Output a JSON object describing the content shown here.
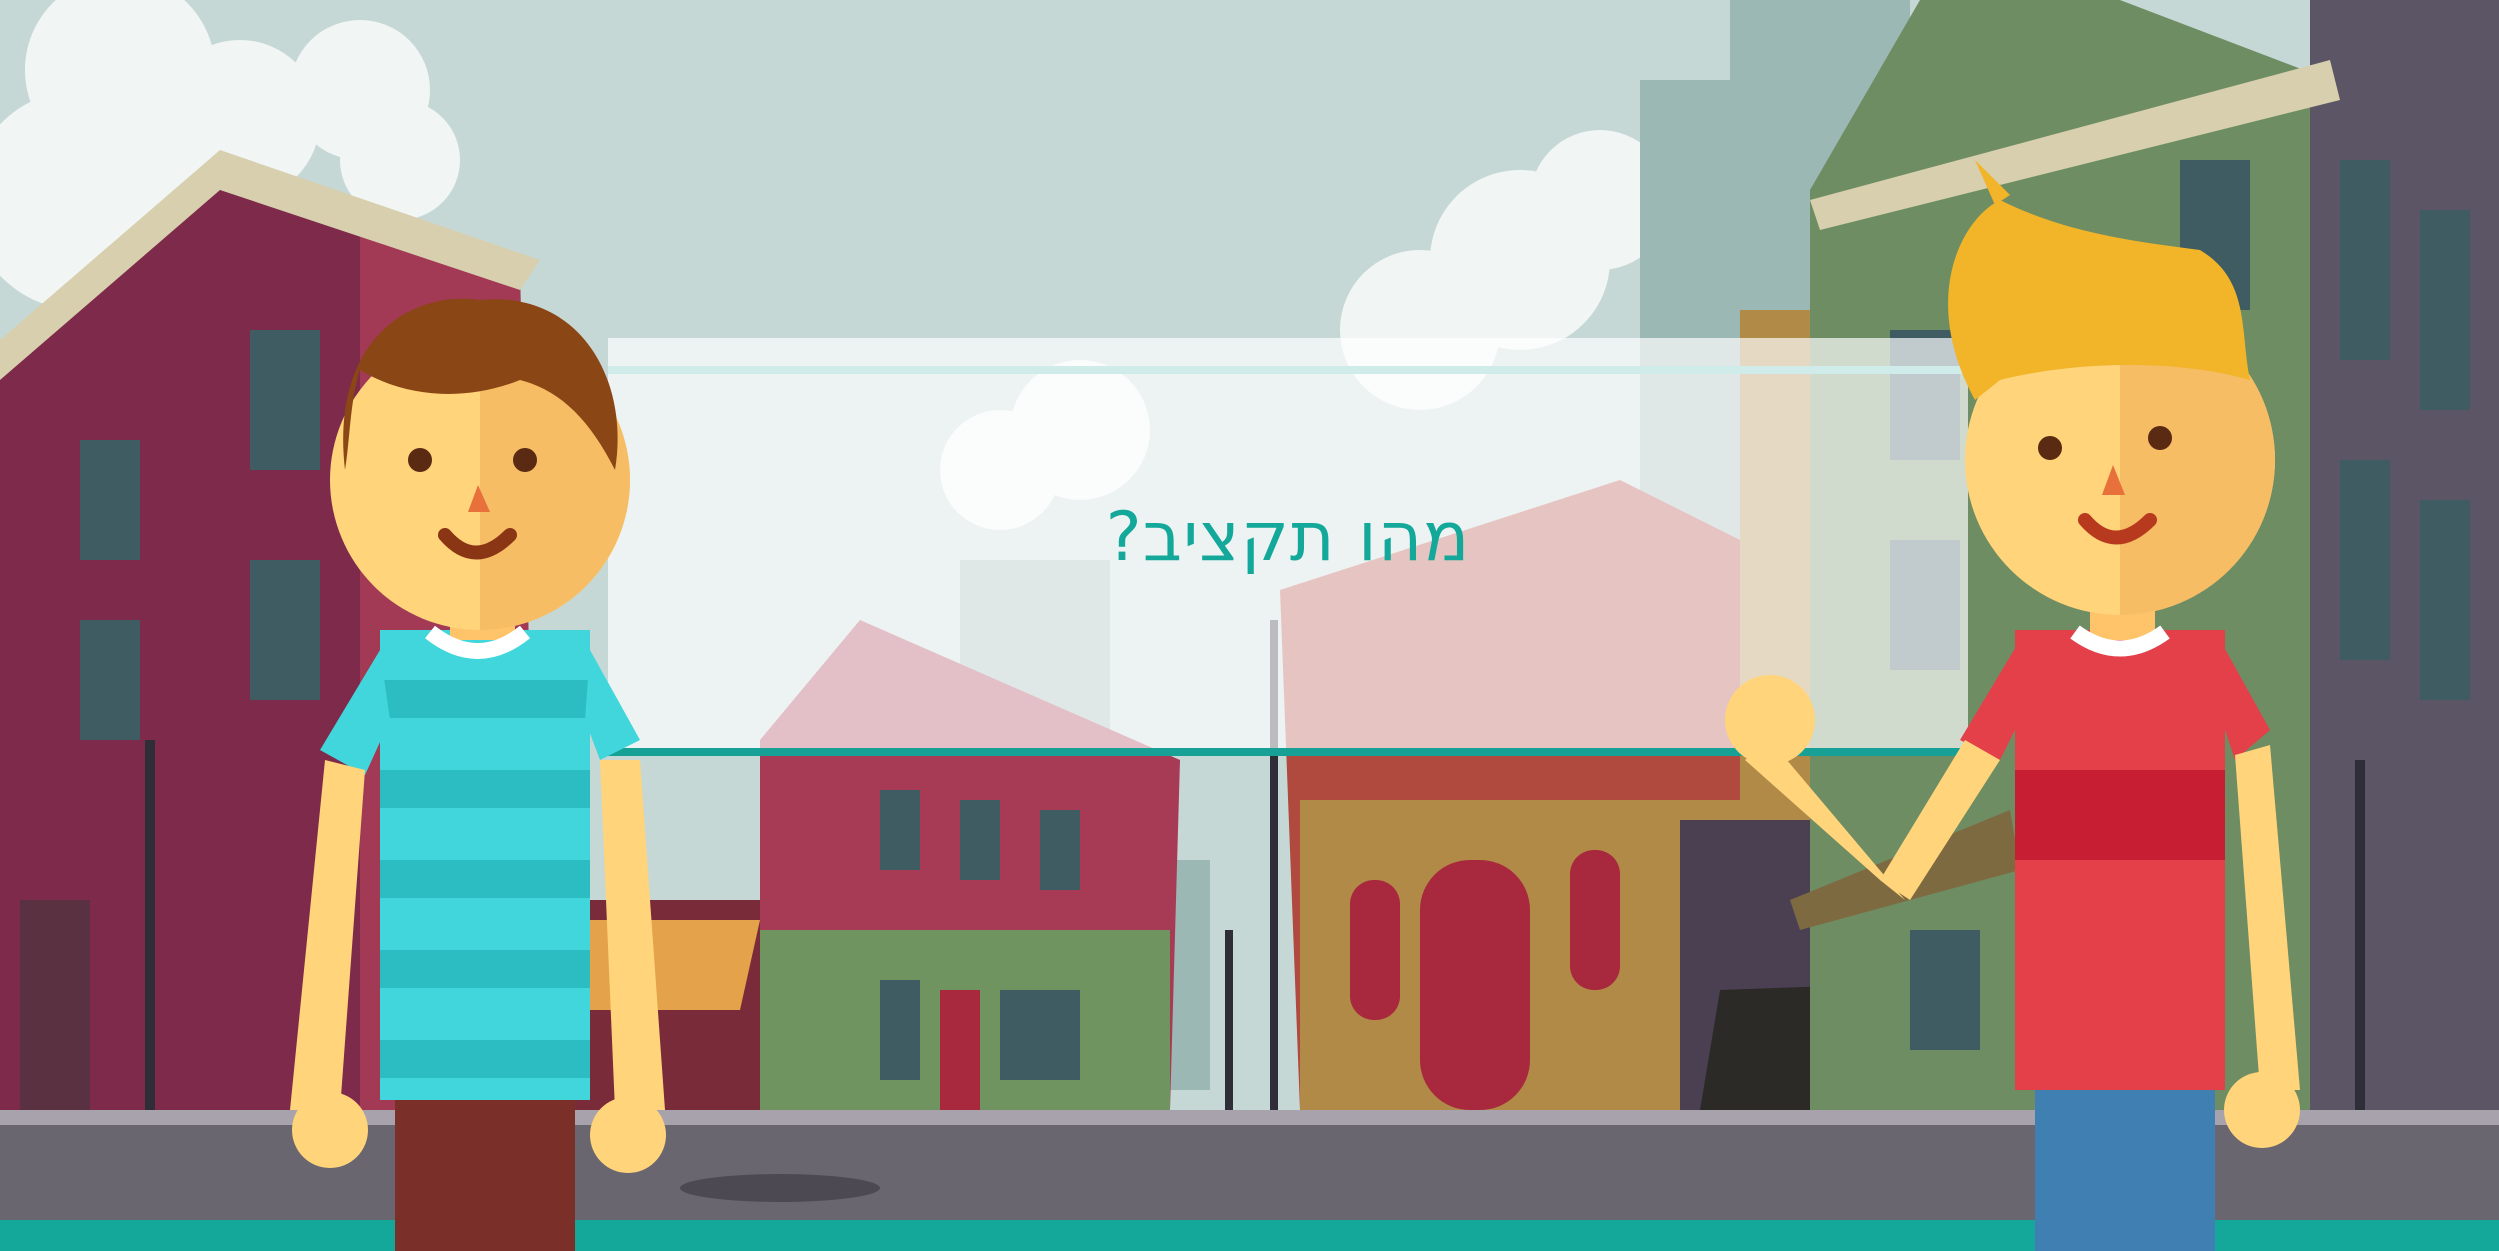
{
  "screen": {
    "title": "מהו תקציב?"
  },
  "colors": {
    "accent": "#13a89a",
    "sky": "#c9dbd9",
    "road": "#6a6670",
    "boy_left_shirt": "#40d6db",
    "boy_right_shirt": "#e3404a",
    "boy_right_hair": "#f2b428",
    "boy_left_hair": "#8a4614",
    "skin": "#ffd47a"
  },
  "icons": {
    "left_character": "boy-striped-shirt-icon",
    "right_character": "boy-waving-icon",
    "background": "city-street-illustration"
  }
}
